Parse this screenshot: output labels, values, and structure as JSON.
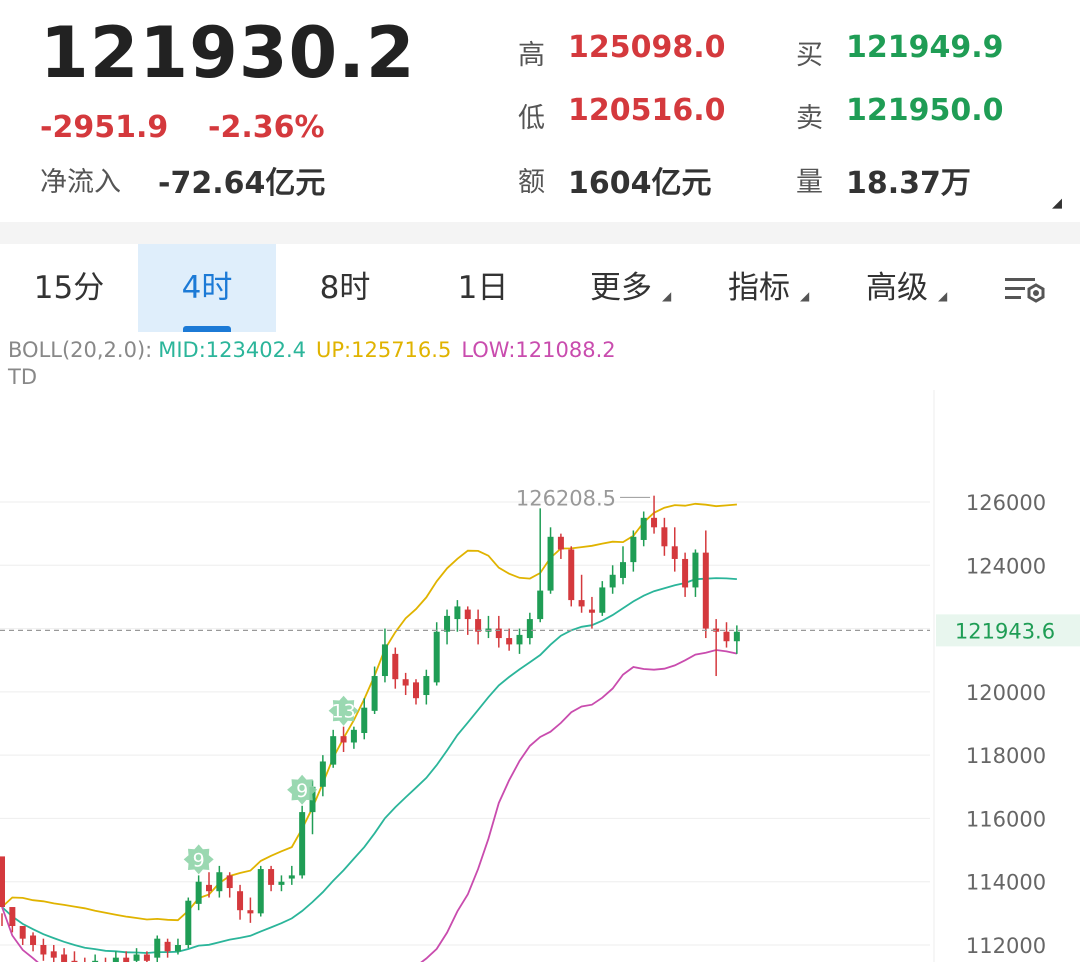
{
  "quote": {
    "last_price": "121930.2",
    "change": "-2951.9",
    "change_pct": "-2.36%",
    "net_inflow_label": "净流入",
    "net_inflow_value": "-72.64亿元",
    "high_label": "高",
    "high_value": "125098.0",
    "low_label": "低",
    "low_value": "120516.0",
    "amount_label": "额",
    "amount_value": "1604亿元",
    "bid_label": "买",
    "bid_value": "121949.9",
    "ask_label": "卖",
    "ask_value": "121950.0",
    "volume_label": "量",
    "volume_value": "18.37万"
  },
  "tabs": [
    {
      "label": "15分",
      "active": false
    },
    {
      "label": "4时",
      "active": true
    },
    {
      "label": "8时",
      "active": false
    },
    {
      "label": "1日",
      "active": false
    },
    {
      "label": "更多",
      "active": false
    },
    {
      "label": "指标",
      "active": false
    },
    {
      "label": "高级",
      "active": false
    }
  ],
  "indicators": {
    "boll_prefix": "BOLL(20,2.0):",
    "mid": "MID:123402.4",
    "up": "UP:125716.5",
    "low": "LOW:121088.2",
    "td": "TD"
  },
  "chart_data": {
    "type": "candlestick",
    "y_ticks": [
      "126000",
      "124000",
      "122000",
      "120000",
      "118000",
      "116000",
      "114000",
      "112000"
    ],
    "ylim": [
      111500,
      127600
    ],
    "current_price_label": "121943.6",
    "current_price": 121943.6,
    "max_label": "126208.5",
    "max_value": 126208.5,
    "td_markers": [
      {
        "index": 19,
        "label": "9"
      },
      {
        "index": 29,
        "label": "9"
      },
      {
        "index": 33,
        "label": "13"
      }
    ],
    "candles": [
      [
        114800,
        113200,
        113000,
        112600
      ],
      [
        113200,
        112600,
        112800,
        112400
      ],
      [
        112600,
        112200,
        112600,
        112000
      ],
      [
        112300,
        112000,
        112400,
        111800
      ],
      [
        112000,
        111700,
        112200,
        111500
      ],
      [
        111800,
        111600,
        112000,
        111300
      ],
      [
        111700,
        111400,
        111900,
        111200
      ],
      [
        111500,
        111300,
        111800,
        111000
      ],
      [
        111300,
        111200,
        111600,
        110900
      ],
      [
        111200,
        111500,
        111700,
        111000
      ],
      [
        111400,
        111300,
        111600,
        111100
      ],
      [
        111300,
        111600,
        111800,
        111200
      ],
      [
        111600,
        111400,
        111800,
        111200
      ],
      [
        111500,
        111700,
        111900,
        111300
      ],
      [
        111700,
        111500,
        111800,
        111300
      ],
      [
        111600,
        112200,
        112300,
        111400
      ],
      [
        112100,
        111800,
        112200,
        111600
      ],
      [
        111800,
        112000,
        112200,
        111700
      ],
      [
        112000,
        113400,
        113500,
        111900
      ],
      [
        113300,
        114000,
        114200,
        113100
      ],
      [
        113900,
        113700,
        114300,
        113500
      ],
      [
        113700,
        114300,
        114500,
        113500
      ],
      [
        114200,
        113800,
        114300,
        113500
      ],
      [
        113700,
        113100,
        113900,
        112800
      ],
      [
        113100,
        113000,
        113500,
        112700
      ],
      [
        113000,
        114400,
        114500,
        112900
      ],
      [
        114400,
        113900,
        114500,
        113700
      ],
      [
        113900,
        114000,
        114200,
        113700
      ],
      [
        114100,
        114200,
        114500,
        113900
      ],
      [
        114200,
        116200,
        116400,
        114100
      ],
      [
        116200,
        117000,
        117200,
        115500
      ],
      [
        117000,
        117800,
        118000,
        116700
      ],
      [
        117700,
        118600,
        118800,
        117600
      ],
      [
        118600,
        118400,
        118900,
        118100
      ],
      [
        118400,
        118800,
        118900,
        118200
      ],
      [
        118700,
        119500,
        119800,
        118500
      ],
      [
        119400,
        120500,
        120800,
        119300
      ],
      [
        120500,
        121500,
        122000,
        120300
      ],
      [
        121200,
        120400,
        121400,
        120100
      ],
      [
        120400,
        120200,
        120600,
        119900
      ],
      [
        120300,
        119800,
        120400,
        119600
      ],
      [
        119900,
        120500,
        120700,
        119600
      ],
      [
        120300,
        121900,
        122200,
        120200
      ],
      [
        121900,
        122400,
        122600,
        121500
      ],
      [
        122300,
        122700,
        122900,
        121900
      ],
      [
        122600,
        122300,
        122700,
        121800
      ],
      [
        122300,
        121900,
        122600,
        121500
      ],
      [
        121900,
        122000,
        122400,
        121700
      ],
      [
        122000,
        121700,
        122400,
        121400
      ],
      [
        121700,
        121500,
        122000,
        121300
      ],
      [
        121500,
        121800,
        122000,
        121200
      ],
      [
        121700,
        122300,
        122500,
        121500
      ],
      [
        122300,
        123200,
        125800,
        122200
      ],
      [
        123200,
        124900,
        125200,
        123100
      ],
      [
        124900,
        124500,
        125000,
        124200
      ],
      [
        124500,
        122900,
        124600,
        122700
      ],
      [
        122900,
        122700,
        123700,
        122500
      ],
      [
        122600,
        122500,
        123000,
        122000
      ],
      [
        122500,
        123300,
        123500,
        122400
      ],
      [
        123300,
        123700,
        124000,
        123100
      ],
      [
        123600,
        124100,
        124600,
        123400
      ],
      [
        124100,
        124900,
        125100,
        123800
      ],
      [
        124800,
        125500,
        125700,
        124600
      ],
      [
        125500,
        125200,
        126200,
        125000
      ],
      [
        125200,
        124600,
        125500,
        124300
      ],
      [
        124600,
        124200,
        125200,
        123800
      ],
      [
        124200,
        123300,
        124400,
        123000
      ],
      [
        123300,
        124400,
        124500,
        123000
      ],
      [
        124400,
        122000,
        125100,
        121700
      ],
      [
        122000,
        121900,
        122300,
        120500
      ],
      [
        121900,
        121600,
        122200,
        121400
      ],
      [
        121600,
        121900,
        122100,
        121200
      ]
    ]
  }
}
